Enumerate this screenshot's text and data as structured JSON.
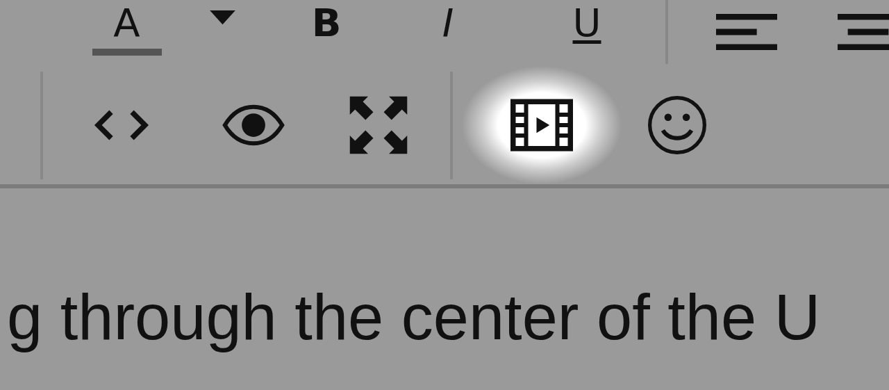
{
  "format_toolbar": {
    "buttons": [
      {
        "kind": "font_color",
        "label": "A"
      },
      {
        "kind": "caret"
      },
      {
        "kind": "bold",
        "label": "B"
      },
      {
        "kind": "italic",
        "label": "I"
      },
      {
        "kind": "underline",
        "label": "U"
      },
      {
        "kind": "separator"
      },
      {
        "kind": "align_left"
      },
      {
        "kind": "align_center"
      }
    ]
  },
  "insert_toolbar": {
    "buttons": [
      {
        "kind": "separator"
      },
      {
        "kind": "code",
        "highlighted": false
      },
      {
        "kind": "preview",
        "highlighted": false
      },
      {
        "kind": "fullscreen",
        "highlighted": false
      },
      {
        "kind": "separator"
      },
      {
        "kind": "video",
        "highlighted": true
      },
      {
        "kind": "emoji",
        "highlighted": false
      }
    ]
  },
  "editor": {
    "lines": [
      "g through the center of the U"
    ]
  }
}
